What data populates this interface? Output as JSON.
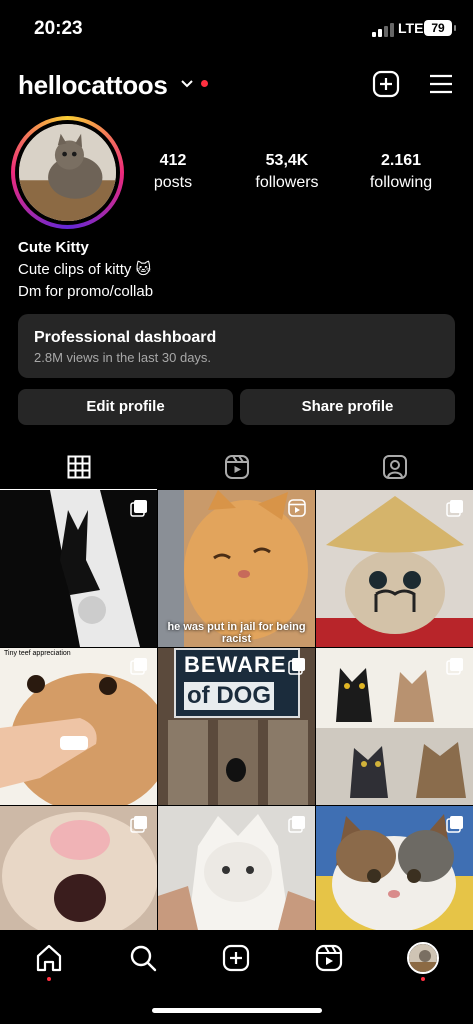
{
  "status_bar": {
    "time": "20:23",
    "network": "LTE",
    "battery": "79"
  },
  "header": {
    "username": "hellocattoos"
  },
  "profile": {
    "stats": [
      {
        "value": "412",
        "label": "posts"
      },
      {
        "value": "53,4K",
        "label": "followers"
      },
      {
        "value": "2.161",
        "label": "following"
      }
    ],
    "name": "Cute Kitty",
    "bio_line1": "Cute clips of kitty 🐱",
    "bio_line2": "Dm for promo/collab"
  },
  "dashboard": {
    "title": "Professional dashboard",
    "subtitle": "2.8M views in the last 30 days."
  },
  "buttons": {
    "edit": "Edit profile",
    "share": "Share profile"
  },
  "tabs": [
    {
      "icon": "grid-icon",
      "active": true
    },
    {
      "icon": "reels-icon",
      "active": false
    },
    {
      "icon": "tagged-icon",
      "active": false
    }
  ],
  "grid_posts": {
    "p2_caption": "he was put in jail for being racist",
    "p4_text": "Tiny teef appreciation",
    "p5_sign1": "BEWARE",
    "p5_sign2": "of DOG"
  },
  "nav": [
    "home-icon",
    "search-icon",
    "create-icon",
    "reels-icon",
    "profile-avatar"
  ],
  "colors": {
    "background": "#000000",
    "surface": "#262626",
    "accent_red": "#ff3040"
  }
}
